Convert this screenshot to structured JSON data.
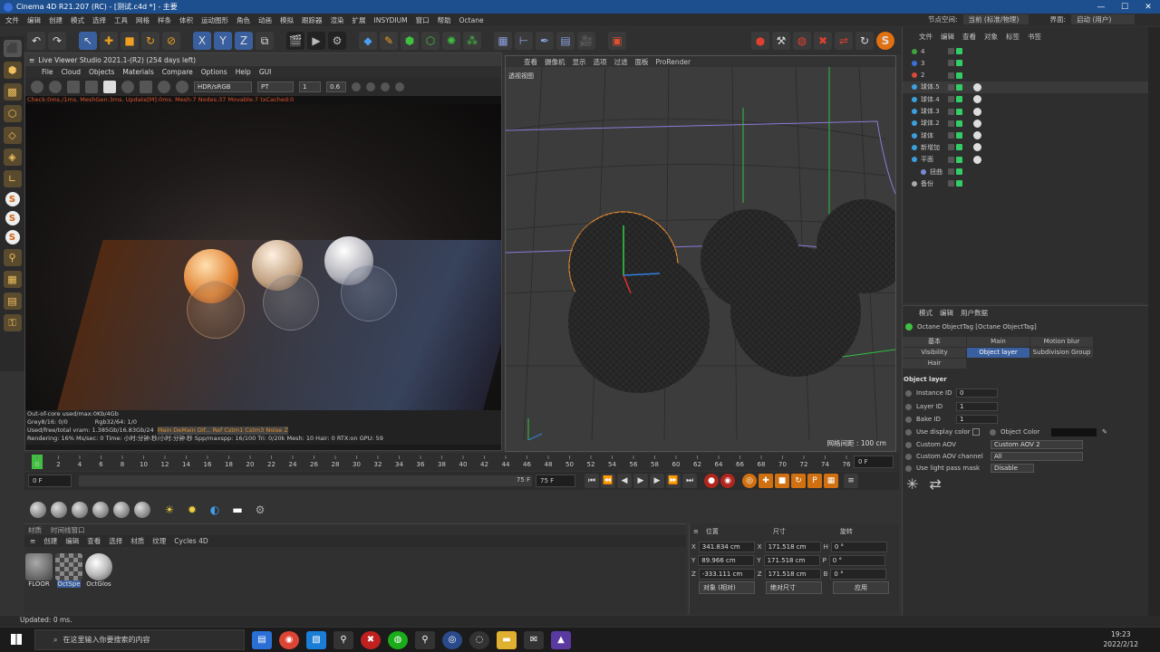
{
  "window": {
    "title": "Cinema 4D R21.207 (RC) - [测试.c4d *] - 主要",
    "min": "—",
    "max": "☐",
    "close": "✕"
  },
  "menubar": [
    "文件",
    "编辑",
    "创建",
    "模式",
    "选择",
    "工具",
    "网格",
    "样条",
    "体积",
    "运动图形",
    "角色",
    "动画",
    "模拟",
    "跟踪器",
    "渲染",
    "扩展",
    "INSYDIUM",
    "窗口",
    "帮助",
    "Octane"
  ],
  "menubar_right": {
    "node_space_label": "节点空间:",
    "node_space_value": "当前 (标准/物理)",
    "interface_label": "界面:",
    "interface_value": "启动 (用户)"
  },
  "lvs": {
    "title": "Live Viewer Studio 2021.1-(R2) (254 days left)",
    "menu": [
      "File",
      "Cloud",
      "Objects",
      "Materials",
      "Compare",
      "Options",
      "Help",
      "GUI"
    ],
    "color_mode": "HDR/sRGB",
    "kernel": "PT",
    "value1": "1",
    "value2": "0.6",
    "status": "Check:0ms./1ms. MeshGen:3ms. Update[M]:0ms. Mesh:7 Nodes:37 Movable:7 txCached:0",
    "info": {
      "outofcore": "Out-of-core used/max:0Kb/4Gb",
      "grey": "Grey8/16: 0/0",
      "rgb": "Rgb32/64: 1/0",
      "vram": "Used/free/total vram: 1.385Gb/16.83Gb/24",
      "passes": "Main DeMain Dif... Ref Cstm1 Cstm3 Noise Z",
      "rendering": "Rendering: 16% Ms/sec: 0  Time: 小时:分钟:秒/小时:分钟:秒  Spp/maxspp: 16/100  Tri: 0/20k  Mesh: 10  Hair: 0  RTX:on  GPU: 59"
    }
  },
  "viewport": {
    "menu": [
      "查看",
      "摄像机",
      "显示",
      "选项",
      "过滤",
      "面板",
      "ProRender"
    ],
    "label": "透视视图",
    "scale": "网格间距 : 100 cm"
  },
  "timeline": {
    "ticks": [
      "0",
      "2",
      "4",
      "6",
      "8",
      "10",
      "12",
      "14",
      "16",
      "18",
      "20",
      "22",
      "24",
      "26",
      "28",
      "30",
      "32",
      "34",
      "36",
      "38",
      "40",
      "42",
      "44",
      "46",
      "48",
      "50",
      "52",
      "54",
      "56",
      "58",
      "60",
      "62",
      "64",
      "66",
      "68",
      "70",
      "72",
      "74",
      "76"
    ],
    "current_frame": "0 F",
    "start": "0 F",
    "end": "75 F",
    "end2": "75 F"
  },
  "materials": {
    "tabs": [
      "材质",
      "时间线窗口"
    ],
    "menu": [
      "创建",
      "编辑",
      "查看",
      "选择",
      "材质",
      "纹理",
      "Cycles 4D"
    ],
    "items": [
      {
        "name": "FLOOR"
      },
      {
        "name": "OctSpe"
      },
      {
        "name": "OctGlos"
      }
    ]
  },
  "coords": {
    "headers": [
      "位置",
      "尺寸",
      "旋转"
    ],
    "rows": [
      {
        "axis": "X",
        "pos": "341.834 cm",
        "saxis": "X",
        "size": "171.518 cm",
        "raxis": "H",
        "rot": "0 °"
      },
      {
        "axis": "Y",
        "pos": "89.966 cm",
        "saxis": "Y",
        "size": "171.518 cm",
        "raxis": "P",
        "rot": "0 °"
      },
      {
        "axis": "Z",
        "pos": "-333.111 cm",
        "saxis": "Z",
        "size": "171.518 cm",
        "raxis": "B",
        "rot": "0 °"
      }
    ],
    "mode": "对象 (相对)",
    "size_mode": "绝对尺寸",
    "apply": "应用"
  },
  "objmgr": {
    "menu": [
      "文件",
      "编辑",
      "查看",
      "对象",
      "标签",
      "书签"
    ],
    "items": [
      {
        "name": "4",
        "color": "#3fa33f"
      },
      {
        "name": "3",
        "color": "#3a6fd8"
      },
      {
        "name": "2",
        "color": "#d84a3a"
      },
      {
        "name": "球体.5",
        "color": "#3ba0e0"
      },
      {
        "name": "球体.4",
        "color": "#3ba0e0"
      },
      {
        "name": "球体.3",
        "color": "#3ba0e0"
      },
      {
        "name": "球体.2",
        "color": "#3ba0e0"
      },
      {
        "name": "球体",
        "color": "#3ba0e0"
      },
      {
        "name": "新增加",
        "color": "#3ba0e0"
      },
      {
        "name": "平面",
        "color": "#3ba0e0"
      },
      {
        "name": "扭曲",
        "color": "#7a8ad8"
      },
      {
        "name": "备份",
        "color": "#aaaaaa"
      }
    ]
  },
  "attr": {
    "menu": [
      "模式",
      "编辑",
      "用户数据"
    ],
    "title": "Octane ObjectTag [Octane ObjectTag]",
    "tabs_row1": [
      "基本",
      "Main",
      "Motion blur"
    ],
    "tabs_row2": [
      "Visibility",
      "Object layer",
      "Subdivision Group"
    ],
    "tabs_row3": [
      "Hair"
    ],
    "section": "Object layer",
    "instance_id_label": "Instance ID",
    "instance_id": "0",
    "layer_id_label": "Layer ID",
    "layer_id": "1",
    "bake_id_label": "Bake ID",
    "bake_id": "1",
    "use_display_color": "Use display color",
    "object_color": "Object Color",
    "custom_aov_label": "Custom AOV",
    "custom_aov": "Custom AOV 2",
    "aov_channel_label": "Custom AOV channel",
    "aov_channel": "All",
    "light_pass_label": "Use light pass mask",
    "light_pass": "Disable"
  },
  "status": "Updated: 0 ms.",
  "taskbar": {
    "search": "在这里输入你要搜索的内容",
    "time": "19:23",
    "date": "2022/2/12"
  }
}
